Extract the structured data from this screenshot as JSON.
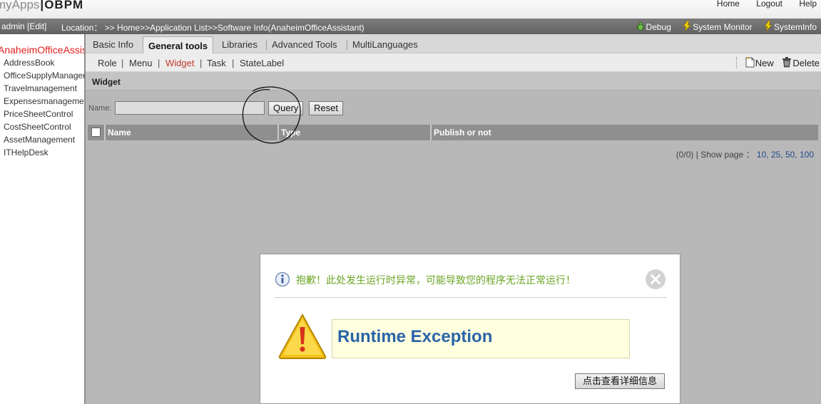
{
  "header": {
    "logo_apps": "myApps",
    "logo_sep": "|",
    "logo_obpm": "OBPM",
    "links": [
      "Home",
      "Logout",
      "Help"
    ]
  },
  "locationbar": {
    "user": "admin [Edit]",
    "location": "Location： >> Home>>Application List>>Software Info(AnaheimOfficeAssistant)",
    "tools": [
      {
        "label": "Debug",
        "icon": "bug-icon"
      },
      {
        "label": "System Monitor",
        "icon": "lightning-icon"
      },
      {
        "label": "SystemInfo",
        "icon": "lightning-icon"
      }
    ]
  },
  "sidebar": {
    "app_title": "AnaheimOfficeAssistant",
    "items": [
      "AddressBook",
      "OfficeSupplyManagement",
      "Travelmanagement",
      "Expensesmanagement",
      "PriceSheetControl",
      "CostSheetControl",
      "AssetManagement",
      "ITHelpDesk"
    ]
  },
  "tabs": {
    "items": [
      "Basic Info",
      "General tools",
      "Libraries",
      "Advanced Tools",
      "MultiLanguages"
    ],
    "active": "General tools"
  },
  "subtabs": {
    "items": [
      "Role",
      "Menu",
      "Widget",
      "Task",
      "StateLabel"
    ],
    "active": "Widget",
    "actions": [
      "New",
      "Delete"
    ]
  },
  "panel": {
    "title": "Widget"
  },
  "search": {
    "label": "Name:",
    "value": "",
    "query_button": "Query",
    "reset_button": "Reset"
  },
  "table": {
    "columns": [
      "Name",
      "Type",
      "Publish or not"
    ],
    "rows": []
  },
  "pager": {
    "count": "(0/0)",
    "divider": "|",
    "show_page_label": "Show page ：",
    "sizes": "10, 25, 50, 100"
  },
  "dialog": {
    "message": "抱歉！此处发生运行时异常，可能导致您的程序无法正常运行！",
    "exception_title": "Runtime Exception",
    "detail_button": "点击查看详细信息",
    "colors": {
      "message": "#6aa524",
      "title": "#2b64a8",
      "box": "#ffffe0"
    }
  }
}
